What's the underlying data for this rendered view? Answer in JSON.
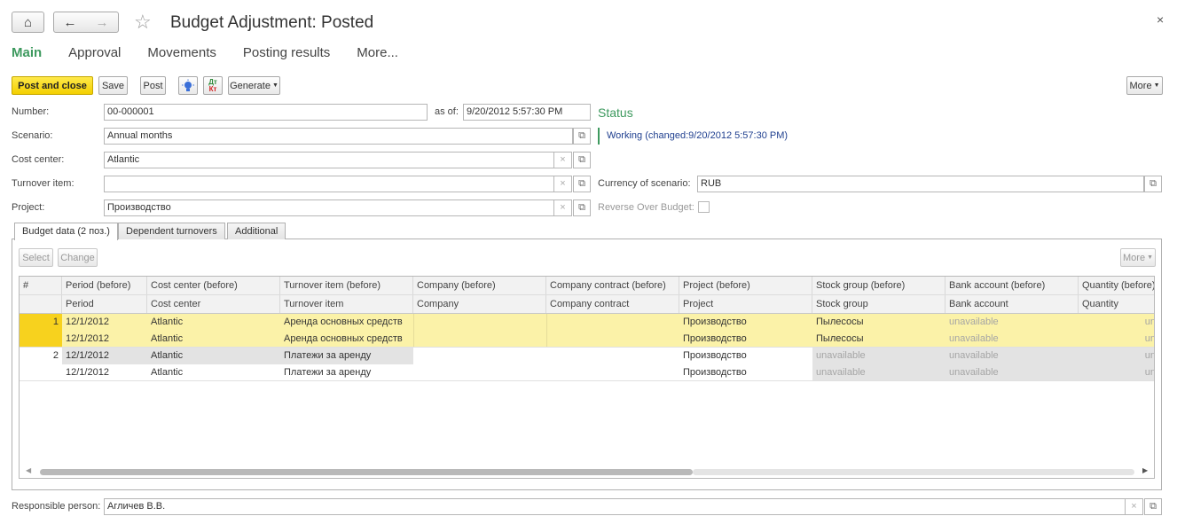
{
  "header": {
    "title": "Budget Adjustment: Posted",
    "home_icon": "⌂",
    "back_icon": "←",
    "forward_icon": "→",
    "star_icon": "☆",
    "close_icon": "×"
  },
  "tabs": [
    {
      "label": "Main",
      "active": true
    },
    {
      "label": "Approval"
    },
    {
      "label": "Movements"
    },
    {
      "label": "Posting results"
    },
    {
      "label": "More..."
    }
  ],
  "toolbar": {
    "post_close": "Post and close",
    "save": "Save",
    "post": "Post",
    "dtkt_top": "Дт",
    "dtkt_bottom": "Кт",
    "generate": "Generate",
    "more": "More"
  },
  "form": {
    "number_label": "Number:",
    "number_value": "00-000001",
    "as_of_label": "as of:",
    "as_of_value": "9/20/2012  5:57:30 PM",
    "status_title": "Status",
    "status_text": "Working (changed:9/20/2012 5:57:30 PM)",
    "scenario_label": "Scenario:",
    "scenario_value": "Annual months",
    "cost_center_label": "Cost center:",
    "cost_center_value": "Atlantic",
    "turnover_item_label": "Turnover item:",
    "turnover_item_value": "",
    "currency_label": "Currency of scenario:",
    "currency_value": "RUB",
    "project_label": "Project:",
    "project_value": "Производство",
    "reverse_label": "Reverse Over Budget:",
    "responsible_label": "Responsible person:",
    "responsible_value": "Агличев В.В."
  },
  "subtabs": [
    {
      "label": "Budget data (2 поз.)",
      "active": true
    },
    {
      "label": "Dependent turnovers"
    },
    {
      "label": "Additional"
    }
  ],
  "table_toolbar": {
    "select": "Select",
    "change": "Change",
    "more": "More"
  },
  "table": {
    "header_row1": [
      "#",
      "Period (before)",
      "Cost center (before)",
      "Turnover item (before)",
      "Company (before)",
      "Company contract (before)",
      "Project (before)",
      "Stock group (before)",
      "Bank account (before)",
      "Quantity (before)"
    ],
    "header_row2": [
      "",
      "Period",
      "Cost center",
      "Turnover item",
      "Company",
      "Company contract",
      "Project",
      "Stock group",
      "Bank account",
      "Quantity"
    ],
    "rows": [
      [
        "1",
        "12/1/2012",
        "Atlantic",
        "Аренда основных средств",
        "",
        "",
        "Производство",
        "Пылесосы",
        "unavailable",
        "un"
      ],
      [
        "",
        "12/1/2012",
        "Atlantic",
        "Аренда основных средств",
        "",
        "",
        "Производство",
        "Пылесосы",
        "unavailable",
        "un"
      ],
      [
        "2",
        "12/1/2012",
        "Atlantic",
        "Платежи за аренду",
        "",
        "",
        "Производство",
        "unavailable",
        "unavailable",
        "un"
      ],
      [
        "",
        "12/1/2012",
        "Atlantic",
        "Платежи за аренду",
        "",
        "",
        "Производство",
        "unavailable",
        "unavailable",
        "un"
      ]
    ]
  },
  "colors": {
    "accent_green": "#3e9a5f",
    "primary_yellow": "#f3cf00",
    "selected_row": "#fbf2a8"
  }
}
